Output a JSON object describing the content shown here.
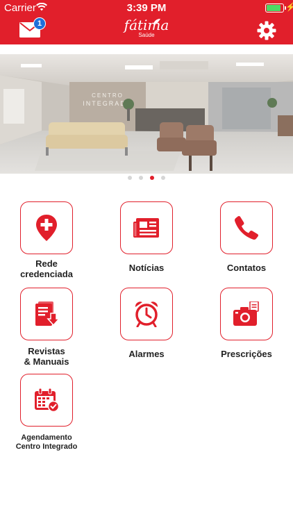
{
  "status_bar": {
    "carrier": "Carrier",
    "time": "3:39 PM"
  },
  "header": {
    "mail_badge": "1",
    "logo_name": "fátima",
    "logo_sub": "Saúde",
    "accent_color": "#e11f2b"
  },
  "carousel": {
    "page_count": 4,
    "active_index": 2
  },
  "menu": [
    {
      "label": "Rede\ncredenciada",
      "icon": "location-plus-icon"
    },
    {
      "label": "Notícias",
      "icon": "newspaper-icon"
    },
    {
      "label": "Contatos",
      "icon": "phone-icon"
    },
    {
      "label": "Revistas\n& Manuais",
      "icon": "magazine-download-icon"
    },
    {
      "label": "Alarmes",
      "icon": "alarm-clock-icon"
    },
    {
      "label": "Prescrições",
      "icon": "camera-document-icon"
    },
    {
      "label": "Agendamento\nCentro Integrado",
      "icon": "calendar-check-icon"
    }
  ]
}
